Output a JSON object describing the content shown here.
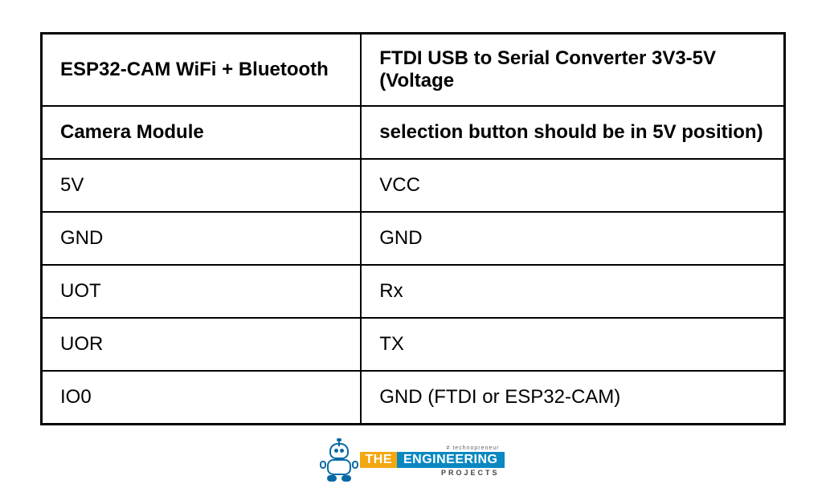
{
  "table": {
    "header": {
      "left_line1": "ESP32-CAM WiFi + Bluetooth",
      "left_line2": "Camera Module",
      "right_line1": "FTDI USB to Serial Converter 3V3-5V (Voltage",
      "right_line2": "selection button should be in 5V position)"
    },
    "rows": [
      {
        "left": "5V",
        "right": "VCC"
      },
      {
        "left": "GND",
        "right": "GND"
      },
      {
        "left": "UOT",
        "right": "Rx"
      },
      {
        "left": "UOR",
        "right": "TX"
      },
      {
        "left": "IO0",
        "right": "GND (FTDI or ESP32-CAM)"
      }
    ]
  },
  "logo": {
    "tagline_top": "# technopreneur",
    "word_the": "THE",
    "word_engineering": "ENGINEERING",
    "word_projects": "PROJECTS"
  }
}
